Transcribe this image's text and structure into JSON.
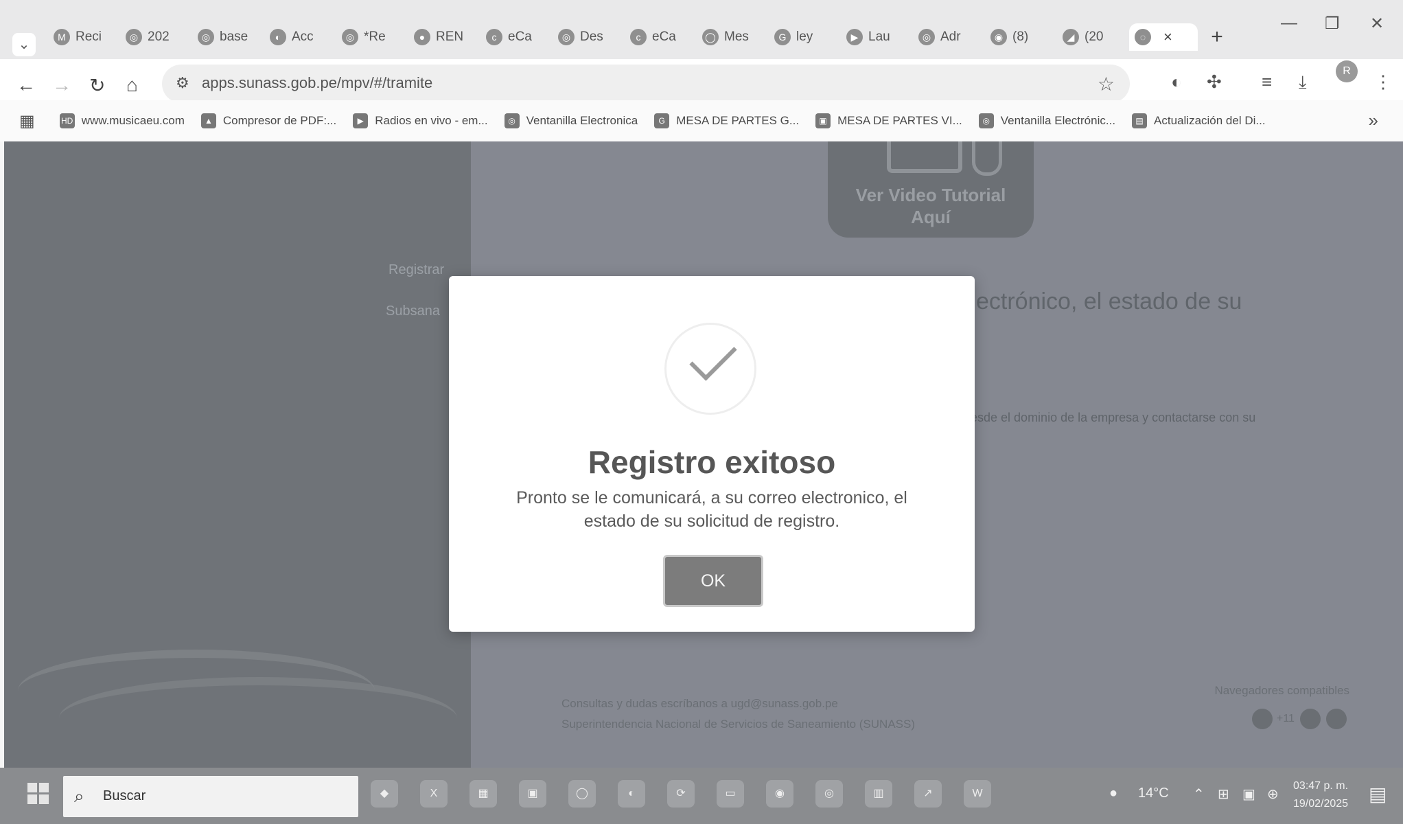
{
  "browser": {
    "tabs": [
      {
        "icon": "M",
        "label": "Reci"
      },
      {
        "icon": "◎",
        "label": "202"
      },
      {
        "icon": "◎",
        "label": "base"
      },
      {
        "icon": "◐",
        "label": "Acc"
      },
      {
        "icon": "◎",
        "label": "*Re"
      },
      {
        "icon": "●",
        "label": "REN"
      },
      {
        "icon": "c",
        "label": "eCa"
      },
      {
        "icon": "◎",
        "label": "Des"
      },
      {
        "icon": "c",
        "label": "eCa"
      },
      {
        "icon": "◯",
        "label": "Mes"
      },
      {
        "icon": "G",
        "label": "ley"
      },
      {
        "icon": "▶",
        "label": "Lau"
      },
      {
        "icon": "◎",
        "label": "Adr"
      },
      {
        "icon": "◉",
        "label": "(8)"
      },
      {
        "icon": "◢",
        "label": "(20"
      }
    ],
    "active_tab_close": "×",
    "new_tab": "+",
    "url": "apps.sunass.gob.pe/mpv/#/tramite",
    "profile_initial": "R",
    "bookmarks": [
      {
        "icon": "HD",
        "label": "www.musicaeu.com"
      },
      {
        "icon": "▲",
        "label": "Compresor de PDF:..."
      },
      {
        "icon": "▶",
        "label": "Radios en vivo - em..."
      },
      {
        "icon": "◎",
        "label": "Ventanilla Electronica"
      },
      {
        "icon": "G",
        "label": "MESA DE PARTES G..."
      },
      {
        "icon": "▣",
        "label": "MESA DE PARTES VI..."
      },
      {
        "icon": "◎",
        "label": "Ventanilla Electrónic..."
      },
      {
        "icon": "▤",
        "label": "Actualización del Di..."
      }
    ],
    "bookmarks_more": "»"
  },
  "page": {
    "side_links": [
      "Registrar",
      "Subsana"
    ],
    "video_card": {
      "line1": "Ver Video Tutorial",
      "line2": "Aquí"
    },
    "bg_heading": "ectrónico, el estado de su",
    "bg_note": "esde el dominio de la empresa y contactarse con su",
    "contact_line1": "Consultas y dudas escríbanos a ugd@sunass.gob.pe",
    "contact_line2": "Superintendencia Nacional de Servicios de Saneamiento (SUNASS)",
    "browsers_label": "Navegadores compatibles",
    "browsers_count": "+11"
  },
  "dialog": {
    "title": "Registro exitoso",
    "body": "Pronto se le comunicará, a su correo electronico, el estado de su solicitud de registro.",
    "ok_label": "OK"
  },
  "taskbar": {
    "search_placeholder": "Buscar",
    "weather": "14°C",
    "time": "03:47 p. m.",
    "date": "19/02/2025"
  }
}
